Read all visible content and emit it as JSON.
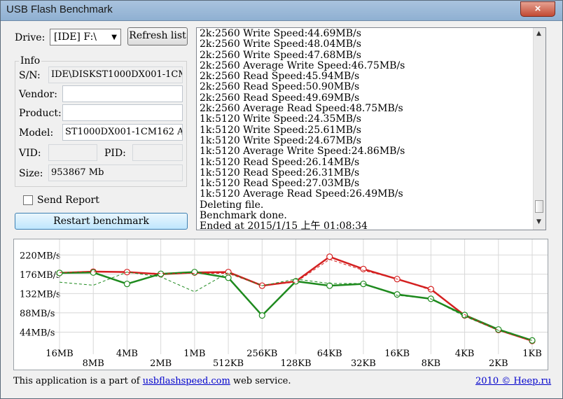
{
  "window": {
    "title": "USB Flash Benchmark",
    "close_label": "×"
  },
  "drive": {
    "label": "Drive:",
    "selected": "[IDE] F:\\",
    "refresh_label": "Refresh list"
  },
  "info": {
    "group_label": "Info",
    "sn_label": "S/N:",
    "sn_value": "IDE\\DISKST1000DX001-1CM",
    "vendor_label": "Vendor:",
    "vendor_value": "",
    "product_label": "Product:",
    "product_value": "",
    "model_label": "Model:",
    "model_value": "ST1000DX001-1CM162 A",
    "vid_label": "VID:",
    "vid_value": "",
    "pid_label": "PID:",
    "pid_value": "",
    "size_label": "Size:",
    "size_value": "953867 Mb"
  },
  "send_report": {
    "label": "Send Report",
    "checked": false
  },
  "restart_label": "Restart benchmark",
  "log": [
    "2k:2560 Write Speed:44.69MB/s",
    "2k:2560 Write Speed:48.04MB/s",
    "2k:2560 Write Speed:47.68MB/s",
    "2k:2560 Average Write Speed:46.75MB/s",
    "2k:2560 Read Speed:45.94MB/s",
    "2k:2560 Read Speed:50.90MB/s",
    "2k:2560 Read Speed:49.69MB/s",
    "2k:2560 Average Read Speed:48.75MB/s",
    "1k:5120 Write Speed:24.35MB/s",
    "1k:5120 Write Speed:25.61MB/s",
    "1k:5120 Write Speed:24.67MB/s",
    "1k:5120 Average Write Speed:24.86MB/s",
    "1k:5120 Read Speed:26.14MB/s",
    "1k:5120 Read Speed:26.31MB/s",
    "1k:5120 Read Speed:27.03MB/s",
    "1k:5120 Average Read Speed:26.49MB/s",
    "Deleting file.",
    "Benchmark done.",
    "Ended at 2015/1/15 上午 01:08:34"
  ],
  "chart_data": {
    "type": "line",
    "categories": [
      "16MB",
      "8MB",
      "4MB",
      "2MB",
      "1MB",
      "512KB",
      "256KB",
      "128KB",
      "64KB",
      "32KB",
      "16KB",
      "8KB",
      "4KB",
      "2KB",
      "1KB"
    ],
    "y_ticks": [
      "220MB/s",
      "176MB/s",
      "132MB/s",
      "88MB/s",
      "44MB/s"
    ],
    "y_tick_values": [
      220,
      176,
      132,
      88,
      44
    ],
    "ylim": [
      0,
      230
    ],
    "grid": true,
    "series": [
      {
        "color": "#d42020",
        "style": "solid",
        "values": [
          179,
          182,
          181,
          176,
          180,
          181,
          150,
          160,
          216,
          188,
          165,
          142,
          82,
          49,
          24
        ]
      },
      {
        "color": "#1e8a1e",
        "style": "solid",
        "values": [
          179,
          180,
          154,
          177,
          181,
          168,
          82,
          160,
          150,
          154,
          130,
          120,
          83,
          50,
          25
        ]
      },
      {
        "color": "#d42020",
        "style": "dashed",
        "values": [
          180,
          182,
          180,
          178,
          178,
          178,
          150,
          158,
          210,
          185,
          165,
          140,
          84,
          48,
          24
        ]
      },
      {
        "color": "#1e8a1e",
        "style": "dashed",
        "values": [
          158,
          151,
          181,
          170,
          136,
          180,
          150,
          165,
          155,
          155,
          128,
          120,
          80,
          48,
          25
        ]
      }
    ]
  },
  "footer": {
    "text_before": "This application is a part of",
    "link": "usbflashspeed.com",
    "text_after": "web service.",
    "copyright": "2010 © Heep.ru"
  }
}
